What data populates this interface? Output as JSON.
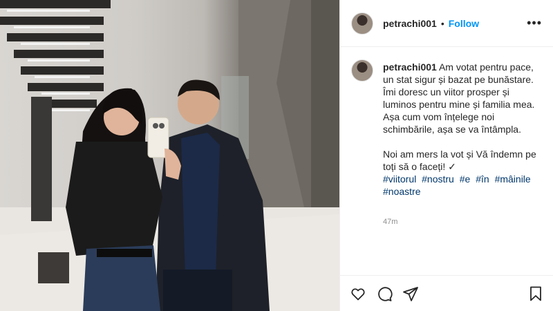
{
  "post": {
    "username": "petrachi001",
    "separator": "•",
    "follow_label": "Follow",
    "more_label": "•••"
  },
  "caption": {
    "username": "petrachi001",
    "paragraph1": "Am votat pentru pace, un stat sigur și bazat pe bunăstare. Îmi doresc un viitor prosper și luminos pentru mine și familia mea. Așa cum vom înțelege noi schimbările, așa se va întâmpla.",
    "paragraph2": "Noi am mers la vot și Vă îndemn pe toți să o faceți! ✓",
    "hashtags": [
      "#viitorul",
      "#nostru",
      "#e",
      "#în",
      "#mâinile",
      "#noastre"
    ],
    "time": "47m"
  },
  "icons": {
    "like": "heart-icon",
    "comment": "comment-icon",
    "share": "share-icon",
    "save": "bookmark-icon"
  }
}
